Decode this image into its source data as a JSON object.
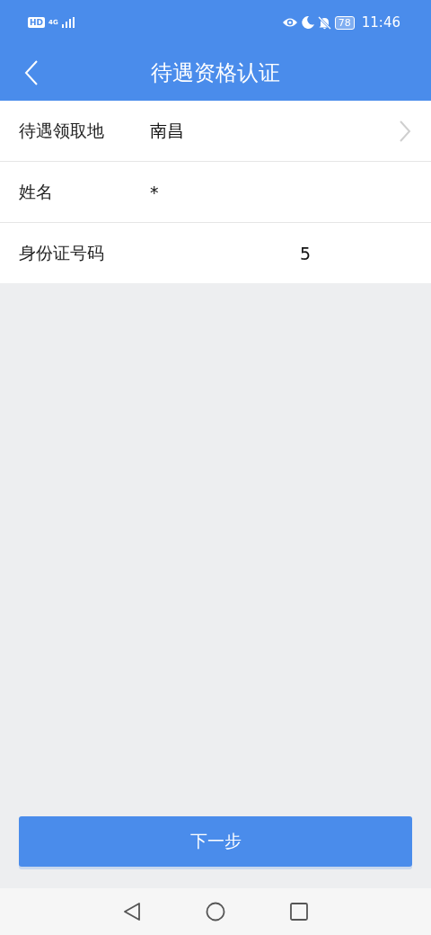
{
  "status_bar": {
    "network_label": "HD",
    "network_type": "4G",
    "battery": "78",
    "time": "11:46"
  },
  "header": {
    "title": "待遇资格认证"
  },
  "form_rows": [
    {
      "kind": "select",
      "label": "待遇领取地",
      "value": "南昌"
    },
    {
      "kind": "text",
      "label": "姓名",
      "value": "*"
    },
    {
      "kind": "masked",
      "label": "身份证号码",
      "value": "5"
    }
  ],
  "next_button": {
    "label": "下一步"
  }
}
